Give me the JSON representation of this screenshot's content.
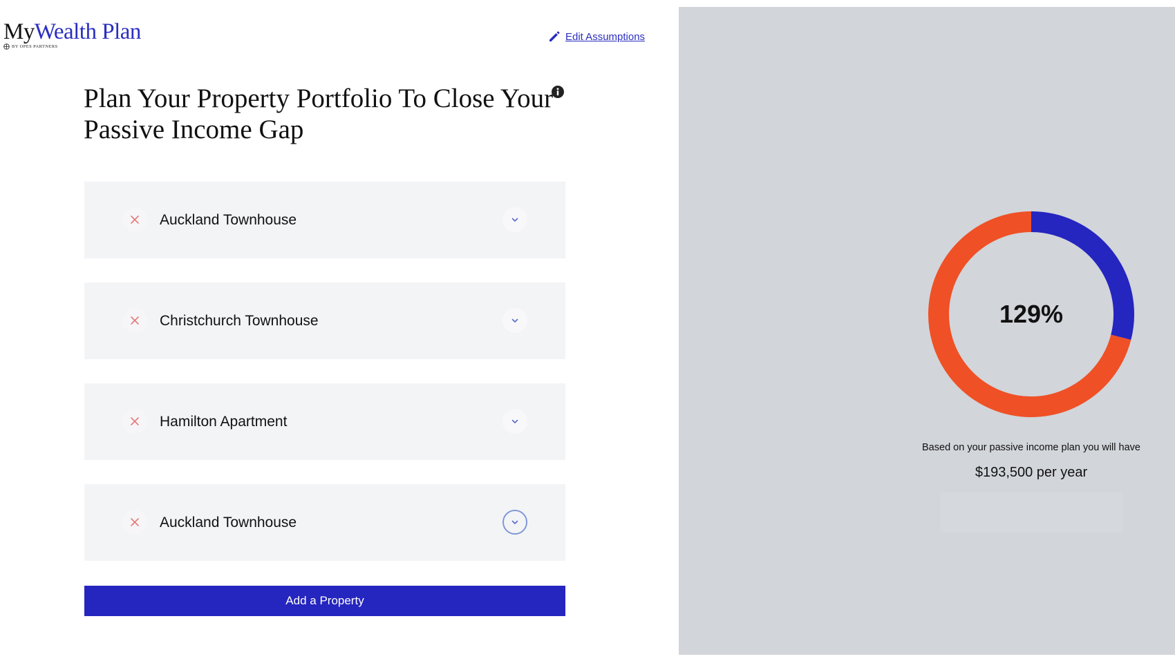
{
  "brand": {
    "name_part1": "My",
    "name_part2": "Wealth Plan",
    "tagline": "BY OPES PARTNERS",
    "accent_color": "#2a2ec0"
  },
  "header": {
    "edit_assumptions_label": "Edit Assumptions",
    "edit_icon": "pencil-icon"
  },
  "page": {
    "title": "Plan Your Property Portfolio To Close Your Passive Income Gap",
    "info_icon": "info-icon"
  },
  "properties": [
    {
      "name": "Auckland Townhouse",
      "expanded": false
    },
    {
      "name": "Christchurch Townhouse",
      "expanded": false
    },
    {
      "name": "Hamilton Apartment",
      "expanded": false
    },
    {
      "name": "Auckland Townhouse",
      "expanded": false,
      "focused": true
    }
  ],
  "actions": {
    "add_property_label": "Add a Property",
    "button_color": "#2525bf"
  },
  "summary": {
    "percent_label": "129%",
    "caption": "Based on your passive income plan you will have",
    "amount": "$193,500 per year"
  },
  "chart_data": {
    "type": "pie",
    "title": "",
    "center_label": "129%",
    "slices": [
      {
        "value": 29,
        "color": "#2525bf"
      },
      {
        "value": 71,
        "color": "#ef5026"
      }
    ]
  }
}
